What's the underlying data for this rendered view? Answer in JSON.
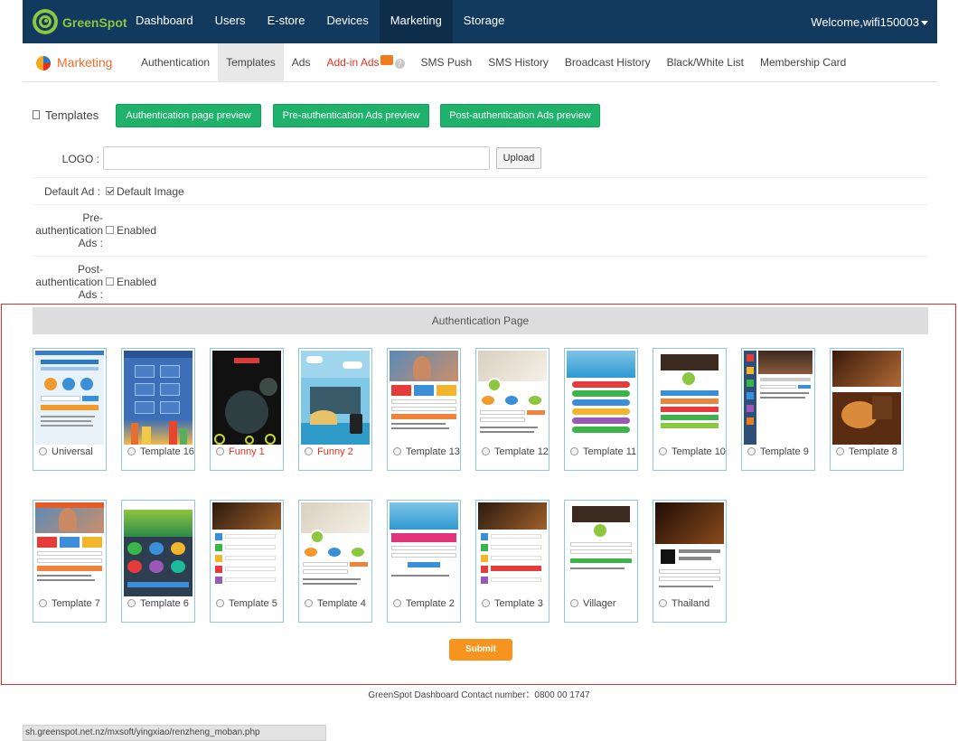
{
  "app": {
    "logo_text": "GreenSpot",
    "welcome": "Welcome,wifi150003"
  },
  "nav": {
    "items": [
      {
        "label": "Dashboard"
      },
      {
        "label": "Users"
      },
      {
        "label": "E-store"
      },
      {
        "label": "Devices"
      },
      {
        "label": "Marketing",
        "active": true
      },
      {
        "label": "Storage"
      }
    ]
  },
  "subnav": {
    "title": "Marketing",
    "tabs": [
      {
        "label": "Authentication"
      },
      {
        "label": "Templates",
        "active": true
      },
      {
        "label": "Ads"
      },
      {
        "label": "Add-in Ads",
        "highlight": true
      },
      {
        "label": "SMS Push"
      },
      {
        "label": "SMS History"
      },
      {
        "label": "Broadcast History"
      },
      {
        "label": "Black/White List"
      },
      {
        "label": "Membership Card"
      }
    ]
  },
  "templates_header": {
    "title": "Templates",
    "buttons": {
      "auth_preview": "Authentication page preview",
      "pre_auth_preview": "Pre-authentication Ads preview",
      "post_auth_preview": "Post-authentication Ads preview"
    }
  },
  "form": {
    "logo_label": "LOGO :",
    "logo_value": "",
    "upload_label": "Upload",
    "default_ad_label": "Default Ad :",
    "default_image_label": "Default Image",
    "default_image_checked": true,
    "pre_auth_label": [
      "Pre-",
      "authentication",
      "Ads :"
    ],
    "pre_auth_enabled_label": "Enabled",
    "pre_auth_enabled": false,
    "post_auth_label": [
      "Post-",
      "authentication",
      "Ads :"
    ],
    "post_auth_enabled_label": "Enabled",
    "post_auth_enabled": false
  },
  "auth_page": {
    "title": "Authentication Page",
    "templates_row1": [
      {
        "label": "Universal",
        "theme": "universal"
      },
      {
        "label": "Template 16",
        "theme": "blue-grid"
      },
      {
        "label": "Funny 1",
        "theme": "dark",
        "red": true
      },
      {
        "label": "Funny 2",
        "theme": "island",
        "red": true
      },
      {
        "label": "Template 13",
        "theme": "photo-man"
      },
      {
        "label": "Template 12",
        "theme": "room"
      },
      {
        "label": "Template 11",
        "theme": "pool"
      },
      {
        "label": "Template 10",
        "theme": "cafe-white"
      },
      {
        "label": "Template 9",
        "theme": "side-menu"
      },
      {
        "label": "Template 8",
        "theme": "coffee"
      }
    ],
    "templates_row2": [
      {
        "label": "Template 7",
        "theme": "photo-man2"
      },
      {
        "label": "Template 6",
        "theme": "green-apps"
      },
      {
        "label": "Template 5",
        "theme": "restaurant-list"
      },
      {
        "label": "Template 4",
        "theme": "room2"
      },
      {
        "label": "Template 2",
        "theme": "pool2"
      },
      {
        "label": "Template 3",
        "theme": "restaurant2"
      },
      {
        "label": "Villager",
        "theme": "cafe-white2"
      },
      {
        "label": "Thailand",
        "theme": "thailand"
      }
    ],
    "submit_label": "Submit"
  },
  "footer": {
    "text": "GreenSpot Dashboard Contact number：0800 00 1747"
  },
  "status_bar": {
    "url": "sh.greenspot.net.nz/mxsoft/yingxiao/renzheng_moban.php"
  },
  "colors": {
    "topbar": "#12395e",
    "accent_green": "#1fb26a",
    "marketing_orange": "#f06c2a",
    "submit_orange": "#f7941d",
    "frame_red": "#d9312f",
    "card_border": "#8ec5e8"
  }
}
